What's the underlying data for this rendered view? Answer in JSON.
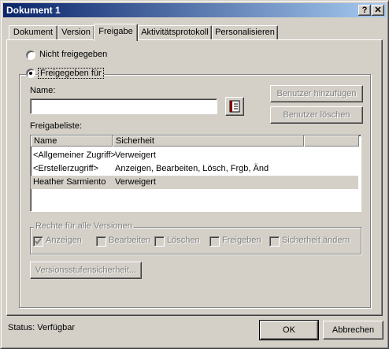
{
  "window": {
    "title": "Dokument 1",
    "help_label": "?",
    "close_label": "✕"
  },
  "tabs": [
    {
      "label": "Dokument"
    },
    {
      "label": "Version"
    },
    {
      "label": "Freigabe"
    },
    {
      "label": "Aktivitätsprotokoll"
    },
    {
      "label": "Personalisieren"
    }
  ],
  "sharing": {
    "not_shared_label": "Nicht freigegeben",
    "shared_for_label": "Freigegeben für",
    "selected": "shared_for",
    "name_label": "Name:",
    "name_value": "",
    "add_user_label": "Benutzer hinzufügen",
    "delete_user_label": "Benutzer löschen",
    "list_label": "Freigabeliste:",
    "columns": [
      "Name",
      "Sicherheit"
    ],
    "rows": [
      {
        "name": "<Allgemeiner Zugriff>",
        "security": "Verweigert"
      },
      {
        "name": "<Erstellerzugriff>",
        "security": "Anzeigen, Bearbeiten, Lösch, Frgb, Änd"
      },
      {
        "name": "Heather Sarmiento",
        "security": "Verweigert"
      }
    ],
    "rights_group_label": "Rechte für alle Versionen",
    "rights": [
      {
        "label": "Anzeigen",
        "checked": true
      },
      {
        "label": "Bearbeiten",
        "checked": false
      },
      {
        "label": "Löschen",
        "checked": false
      },
      {
        "label": "Freigeben",
        "checked": false
      },
      {
        "label": "Sicherheit ändern",
        "checked": false
      }
    ],
    "version_security_label": "Versionsstufensicherheit..."
  },
  "footer": {
    "status": "Status: Verfügbar",
    "ok_label": "OK",
    "cancel_label": "Abbrechen"
  },
  "colors": {
    "title_start": "#0a246a",
    "title_end": "#a6caf0",
    "face": "#d4d0c8",
    "selected_row": "#d4d0c8"
  }
}
